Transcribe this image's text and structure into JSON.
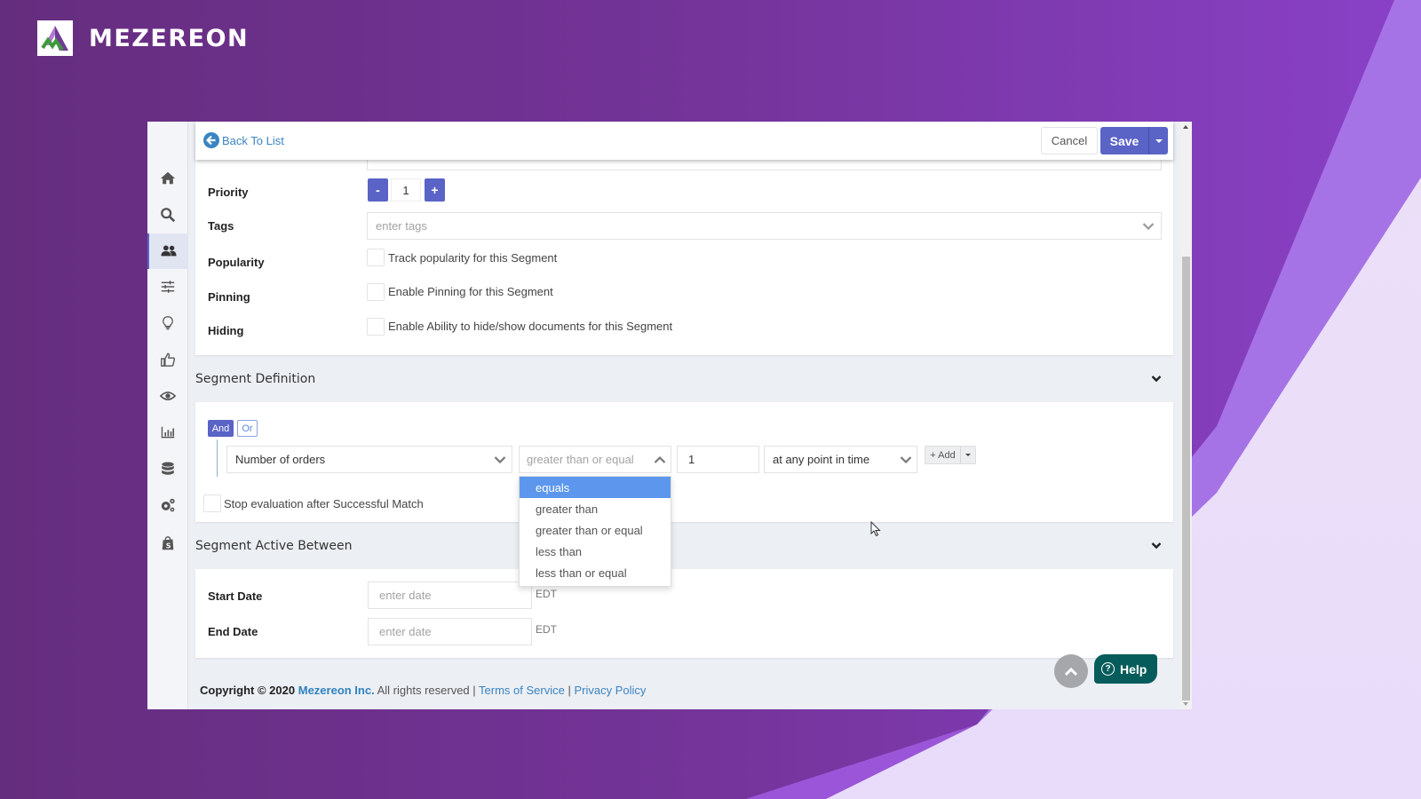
{
  "brand": {
    "name": "MEZEREON"
  },
  "sidebar": {
    "items": [
      {
        "icon": "home-icon",
        "active": false
      },
      {
        "icon": "search-icon",
        "active": false
      },
      {
        "icon": "users-icon",
        "active": true
      },
      {
        "icon": "sliders-icon",
        "active": false
      },
      {
        "icon": "lightbulb-icon",
        "active": false
      },
      {
        "icon": "thumbs-up-icon",
        "active": false
      },
      {
        "icon": "eye-icon",
        "active": false
      },
      {
        "icon": "bar-chart-icon",
        "active": false
      },
      {
        "icon": "database-icon",
        "active": false
      },
      {
        "icon": "gears-icon",
        "active": false
      },
      {
        "icon": "shopify-bag-icon",
        "active": false
      }
    ]
  },
  "toolbar": {
    "back_label": "Back To List",
    "cancel_label": "Cancel",
    "save_label": "Save"
  },
  "form": {
    "priority": {
      "label": "Priority",
      "value": "1",
      "minus": "-",
      "plus": "+"
    },
    "tags": {
      "label": "Tags",
      "placeholder": "enter tags"
    },
    "popularity": {
      "label": "Popularity",
      "checkbox_label": "Track popularity for this Segment",
      "checked": false
    },
    "pinning": {
      "label": "Pinning",
      "checkbox_label": "Enable Pinning for this Segment",
      "checked": false
    },
    "hiding": {
      "label": "Hiding",
      "checkbox_label": "Enable Ability to hide/show documents for this Segment",
      "checked": false
    }
  },
  "segment_definition": {
    "title": "Segment Definition",
    "and_label": "And",
    "or_label": "Or",
    "rule": {
      "field": "Number of orders",
      "operator_placeholder": "greater than or equal",
      "value": "1",
      "timeframe": "at any point in time"
    },
    "add_label": "+ Add",
    "operator_options": [
      {
        "label": "equals",
        "highlighted": true
      },
      {
        "label": "greater than",
        "highlighted": false
      },
      {
        "label": "greater than or equal",
        "highlighted": false
      },
      {
        "label": "less than",
        "highlighted": false
      },
      {
        "label": "less than or equal",
        "highlighted": false
      }
    ],
    "stop_eval_label": "Stop evaluation after Successful Match"
  },
  "segment_active": {
    "title": "Segment Active Between",
    "start_label": "Start Date",
    "end_label": "End Date",
    "date_placeholder": "enter date",
    "timezone": "EDT"
  },
  "footer": {
    "copyright": "Copyright © 2020",
    "company": "Mezereon Inc.",
    "rights": "All rights reserved |",
    "terms": "Terms of Service",
    "sep": "|",
    "privacy": "Privacy Policy"
  },
  "help": {
    "label": "Help",
    "icon_glyph": "?"
  },
  "colors": {
    "primary": "#5a63c6",
    "link": "#3b84c2",
    "help_bg": "#065c5b",
    "dropdown_highlight": "#5c97ed"
  }
}
